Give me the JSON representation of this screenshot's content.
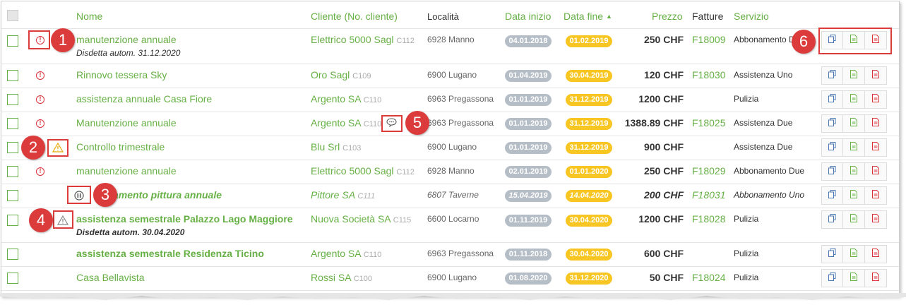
{
  "header": {
    "nome": "Nome",
    "cliente": "Cliente (No. cliente)",
    "localita": "Località",
    "data_inizio": "Data inizio",
    "data_fine": "Data fine",
    "sort_indicator": "▲",
    "prezzo": "Prezzo",
    "fatture": "Fatture",
    "servizio": "Servizio"
  },
  "rows": [
    {
      "status": "alert-icon",
      "name": "manutenzione annuale",
      "name_style": "normal",
      "sub": "Disdetta autom. 31.12.2020",
      "client": "Elettrico 5000 Sagl",
      "client_no": "C112",
      "loc": "6928 Manno",
      "start": "04.01.2018",
      "end": "01.02.2019",
      "price": "250 CHF",
      "invoice": "F18009",
      "service": "Abbonamento Due"
    },
    {
      "status": "alert-icon",
      "name": "Rinnovo tessera Sky",
      "name_style": "normal",
      "sub": "",
      "client": "Oro Sagl",
      "client_no": "C109",
      "loc": "6900 Lugano",
      "start": "01.04.2019",
      "end": "30.04.2019",
      "price": "120 CHF",
      "invoice": "F18030",
      "service": "Assistenza Uno"
    },
    {
      "status": "alert-icon",
      "name": "assistenza annuale Casa Fiore",
      "name_style": "normal",
      "sub": "",
      "client": "Argento SA",
      "client_no": "C110",
      "loc": "6963 Pregassona",
      "start": "01.01.2019",
      "end": "31.12.2019",
      "price": "1200 CHF",
      "invoice": "",
      "service": "Pulizia"
    },
    {
      "status": "alert-icon",
      "name": "Manutenzione annuale",
      "name_style": "normal",
      "sub": "",
      "client": "Argento SA",
      "client_no": "C110",
      "loc": "6963 Pregassona",
      "start": "01.01.2019",
      "end": "31.12.2019",
      "price": "1388.89 CHF",
      "invoice": "F18025",
      "service": "Assistenza Due"
    },
    {
      "status": "warning-icon",
      "name": "Controllo trimestrale",
      "name_style": "normal",
      "sub": "",
      "client": "Blu Srl",
      "client_no": "C103",
      "loc": "6900 Lugano",
      "start": "01.01.2019",
      "end": "31.12.2019",
      "price": "900 CHF",
      "invoice": "",
      "service": "Assistenza Due"
    },
    {
      "status": "alert-icon",
      "name": "manutenzione annuale",
      "name_style": "normal",
      "sub": "",
      "client": "Elettrico 5000 Sagl",
      "client_no": "C112",
      "loc": "6928 Manno",
      "start": "02.01.2019",
      "end": "01.01.2020",
      "price": "250 CHF",
      "invoice": "F18029",
      "service": "Abbonamento Due"
    },
    {
      "status": "pause-icon",
      "name": "amento pittura annuale",
      "name_style": "bold-italic",
      "sub": "",
      "client": "Pittore SA",
      "client_no": "C111",
      "loc": "6807 Taverne",
      "start": "15.04.2019",
      "end": "14.04.2020",
      "price": "200 CHF",
      "invoice": "F18031",
      "service": "Abbonamento Uno"
    },
    {
      "status": "warning-grey-icon",
      "name": "assistenza semestrale Palazzo Lago Maggiore",
      "name_style": "bold",
      "sub": "Disdetta autom. 30.04.2020",
      "client": "Nuova Società SA",
      "client_no": "C115",
      "loc": "6600 Locarno",
      "start": "01.11.2019",
      "end": "30.04.2020",
      "price": "1200 CHF",
      "invoice": "F18028",
      "service": "Pulizia"
    },
    {
      "status": "",
      "name": "assistenza semestrale Residenza Ticino",
      "name_style": "bold",
      "sub": "",
      "client": "Argento SA",
      "client_no": "C110",
      "loc": "6963 Pregassona",
      "start": "01.11.2018",
      "end": "30.04.2020",
      "price": "600 CHF",
      "invoice": "",
      "service": "Pulizia"
    },
    {
      "status": "",
      "name": "Casa Bellavista",
      "name_style": "normal",
      "sub": "",
      "client": "Rossi SA",
      "client_no": "C100",
      "loc": "6900 Lugano",
      "start": "01.08.2020",
      "end": "31.12.2020",
      "price": "50 CHF",
      "invoice": "F18024",
      "service": "Pulizia"
    }
  ],
  "callouts": [
    "1",
    "2",
    "3",
    "4",
    "5",
    "6"
  ],
  "colors": {
    "accent": "#66b045",
    "alert": "#d9343a",
    "start_badge": "#b5bdc6",
    "end_badge": "#f7c622",
    "callout": "#dc3b3b"
  },
  "action_icons": [
    "copy-icon",
    "document-green-icon",
    "document-red-icon"
  ]
}
